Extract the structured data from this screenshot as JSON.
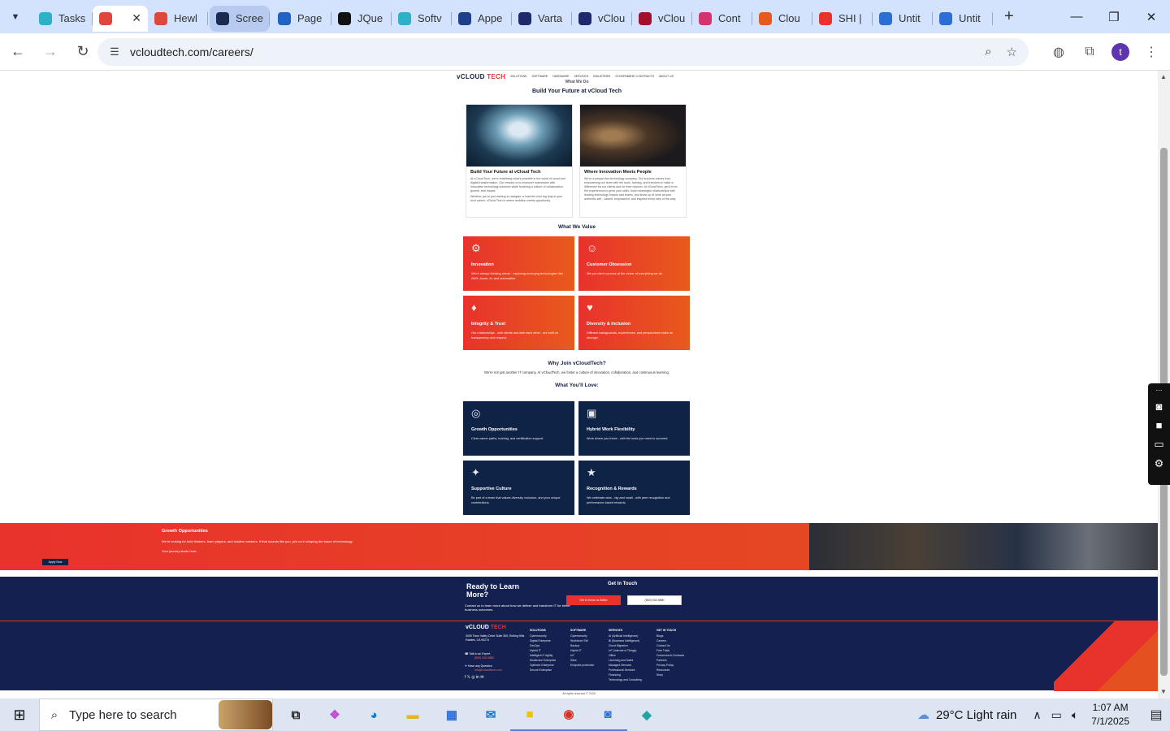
{
  "browser": {
    "tabs": [
      {
        "label": "Tasks",
        "color": "#2db1c9"
      },
      {
        "label": "",
        "color": "#e0463c",
        "active": true
      },
      {
        "label": "Hewl",
        "color": "#e0463c"
      },
      {
        "label": "Scree",
        "color": "#1a2b4f",
        "highlight": true
      },
      {
        "label": "Page",
        "color": "#2163c4"
      },
      {
        "label": "JQue",
        "color": "#111111"
      },
      {
        "label": "Softv",
        "color": "#2db1c9"
      },
      {
        "label": "Appe",
        "color": "#1e3f8a"
      },
      {
        "label": "Varta",
        "color": "#1e2a6b"
      },
      {
        "label": "vClou",
        "color": "#1e2a6b"
      },
      {
        "label": "vClou",
        "color": "#a0102a"
      },
      {
        "label": "Cont",
        "color": "#d6336c"
      },
      {
        "label": "Clou",
        "color": "#e85a1c"
      },
      {
        "label": "SHI |",
        "color": "#e8322c"
      },
      {
        "label": "Untit",
        "color": "#2b6fd6"
      },
      {
        "label": "Untit",
        "color": "#2b6fd6"
      }
    ],
    "url": "vcloudtech.com/careers/",
    "profile_initial": "t"
  },
  "site": {
    "logo_a": "vCLOUD",
    "logo_b": "TECH",
    "nav": [
      "SOLUTIONS",
      "SOFTWARE",
      "HARDWARE",
      "SERVICES",
      "INDUSTRIES",
      "GOVERNMENT CONTRACTS",
      "ABOUT US"
    ],
    "what_we_do": "What We Do",
    "build_title": "Build Your Future at vCloud Tech",
    "cards": [
      {
        "title": "Build Your Future at vCloud Tech",
        "text1": "At vCloud Tech, we're redefining what's possible in the world of cloud and digital transformation. Our mission is to empower businesses with innovative technology solutions while fostering a culture of collaboration, growth, and impact.",
        "text2": "Whether you're just starting to navigate or lead the next big leap in your tech career, vCloud Tech is where ambition meets opportunity."
      },
      {
        "title": "Where Innovation Meets People",
        "text1": "We're a people-first technology company. Our success comes from empowering our team with the tools, training, and freedom to make a difference for our clients and for their mission. At vCloudTech, get it from the experiences to grow your skills, build meaningful relationships with leading technology brands and teams, and show up at work as your authentic self - valued, empowered, and inspired every step of the way.",
        "text2": ""
      }
    ],
    "values_title": "What We Value",
    "values": [
      {
        "title": "Innovation",
        "text": "We're always thinking ahead - exploring emerging technologies like AWS, Azure, AI, and automation.",
        "icon": "innovation-icon",
        "glyph": "⚙"
      },
      {
        "title": "Customer Obsession",
        "text": "We put client success at the center of everything we do.",
        "icon": "customer-icon",
        "glyph": "☺"
      },
      {
        "title": "Integrity & Trust",
        "text": "Our relationships - with clients and with each other - are built on transparency and respect.",
        "icon": "integrity-icon",
        "glyph": "♦"
      },
      {
        "title": "Diversity & Inclusion",
        "text": "Different backgrounds, experiences, and perspectives make us stronger.",
        "icon": "diversity-icon",
        "glyph": "♥"
      }
    ],
    "why_title": "Why Join vCloudTech?",
    "why_text": "We're not just another IT company. At vCloudTech, we foster a culture of innovation, collaboration, and continuous learning.",
    "love_title": "What You'll Love:",
    "loves": [
      {
        "title": "Growth Opportunities",
        "text": "Clear career paths, training, and certification support.",
        "icon": "growth-icon",
        "glyph": "◎"
      },
      {
        "title": "Hybrid Work Flexibility",
        "text": "Work where you thrive - with the tools you need to succeed.",
        "icon": "hybrid-icon",
        "glyph": "▣"
      },
      {
        "title": "Supportive Culture",
        "text": "Be part of a team that values diversity, inclusion, and your unique contributions.",
        "icon": "culture-icon",
        "glyph": "✦"
      },
      {
        "title": "Recognition & Rewards",
        "text": "We celebrate wins - big and small - with peer recognition and performance-based rewards.",
        "icon": "rewards-icon",
        "glyph": "★"
      }
    ],
    "growth_banner": {
      "title": "Growth Opportunities",
      "text": "We're looking for bold thinkers, team players, and solution seekers. If that sounds like you, join us in shaping the future of technology.",
      "journey": "Your journey starts here.",
      "button": "Apply Now"
    },
    "cta": {
      "title": "Ready to Learn More?",
      "text": "Contact us to learn more about how we deliver and transform IT for better business outcomes.",
      "get_in_touch": "Get In Touch",
      "btn1": "Get to Know us Better",
      "btn2": "(800) 032-9880"
    },
    "footer": {
      "address": "3000 Town Valley Drive Suite 300, Rolling Hills Estates, CA 90274",
      "talk": "Talk to an Expert",
      "phone": "(800) 032-9880",
      "question": "Have any Question",
      "email": "info@vcloudtech.com",
      "cols": [
        {
          "head": "SOLUTIONS",
          "items": [
            "Cybersecurity",
            "Digital Enterprise",
            "DevOps",
            "Hybrid IT",
            "Intelligent IT Agility",
            "Modernize Enterprise",
            "Optimize Enterprise",
            "Secure Enterprise"
          ]
        },
        {
          "head": "SOFTWARE",
          "items": [
            "Cybersecurity",
            "Workforce SW",
            "Backup",
            "Hybrid IT",
            "IoT",
            "Sites",
            "Endpoint protection"
          ]
        },
        {
          "head": "SERVICES",
          "items": [
            "AI (Artificial Intelligence)",
            "BI (Business Intelligence)",
            "Cloud Migration",
            "IoT (Internet of Things)",
            "Office",
            "Licensing and Sales",
            "Managed Services",
            "Professional Services",
            "Financing",
            "Technology and Consulting"
          ]
        },
        {
          "head": "GET IN TOUCH",
          "items": [
            "Blogs",
            "Careers",
            "Contact Us",
            "Free Trials",
            "Government Contracts",
            "Partners",
            "Privacy Policy",
            "Resources",
            "Story"
          ]
        }
      ],
      "copyright": "All rights reserved © 2025"
    }
  },
  "taskbar": {
    "search_placeholder": "Type here to search",
    "weather": "29°C  Light rain",
    "time": "1:07 AM",
    "date": "7/1/2025"
  }
}
